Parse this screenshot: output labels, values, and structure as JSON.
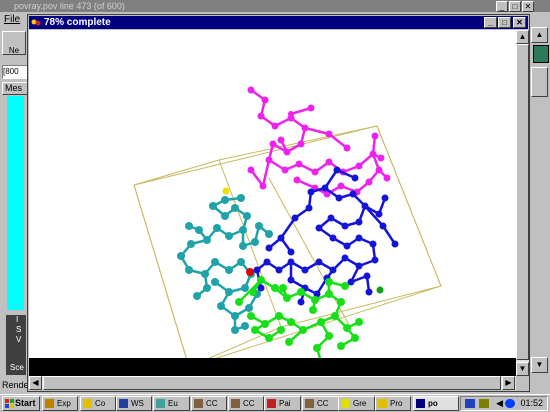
{
  "back_window": {
    "title": "povray.pov line 473 (of 600)",
    "menu_file": "File",
    "toolbar_label": "Ne",
    "resolution": "[800",
    "messages_tab": "Mes",
    "side_letters": [
      "I",
      "S",
      "V"
    ],
    "side_label": "Sce",
    "status": "Rende"
  },
  "render_window": {
    "title": "78% complete",
    "progress": 0.78
  },
  "taskbar": {
    "start_label": "Start",
    "tasks": [
      {
        "label": "Exp",
        "icon": "explorer-icon"
      },
      {
        "label": "Co",
        "icon": "folder-icon"
      },
      {
        "label": "WS",
        "icon": "ftp-icon"
      },
      {
        "label": "Eu",
        "icon": "mail-icon"
      },
      {
        "label": "CC",
        "icon": "app-icon"
      },
      {
        "label": "CC",
        "icon": "app-icon"
      },
      {
        "label": "Pai",
        "icon": "paint-icon"
      },
      {
        "label": "CC",
        "icon": "app-icon"
      },
      {
        "label": "Gre",
        "icon": "smiley-icon"
      },
      {
        "label": "Pro",
        "icon": "folder-icon"
      },
      {
        "label": "po",
        "icon": "povray-icon"
      }
    ],
    "clock": "01:52"
  },
  "colors": {
    "desktop": "#008080",
    "title_active": "#000080",
    "title_inactive": "#808080",
    "molecule_magenta": "#ee22ee",
    "molecule_blue": "#1414d8",
    "molecule_teal": "#1fa3a8",
    "molecule_green": "#18e018",
    "unit_cell": "#c8b860"
  }
}
